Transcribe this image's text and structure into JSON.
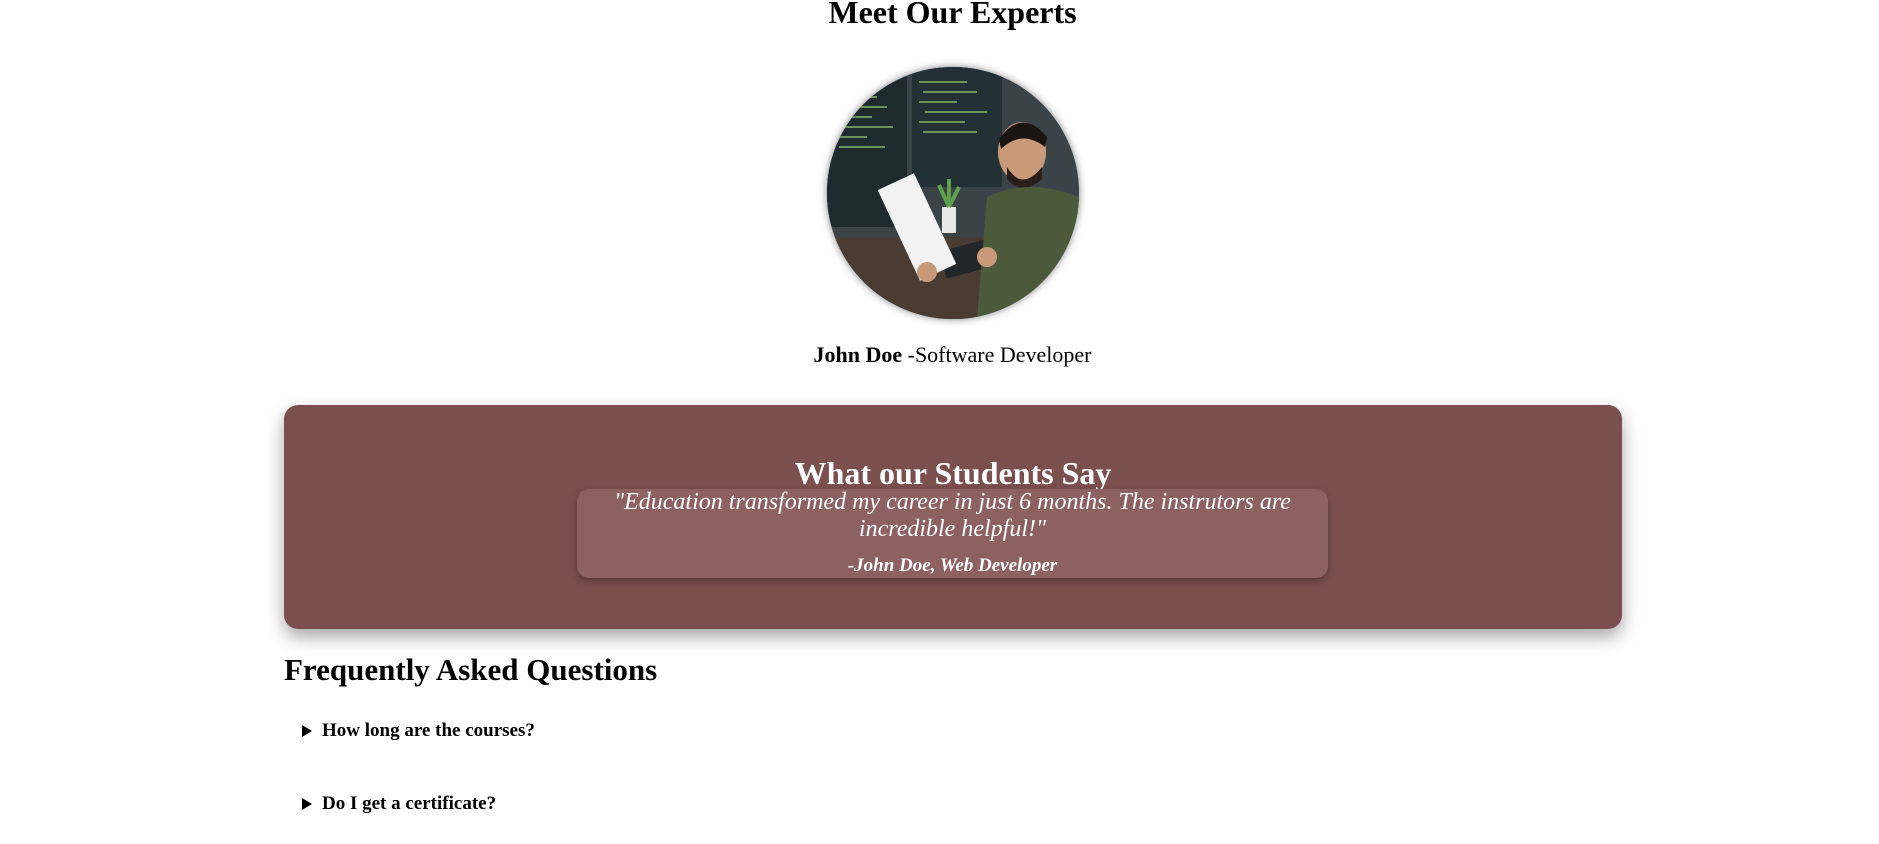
{
  "experts": {
    "title": "Meet Our Experts",
    "member": {
      "name": "John Doe",
      "role": "-Software Developer",
      "photo_icon": "developer-at-desk-photo"
    }
  },
  "testimonials": {
    "title": "What our Students Say",
    "quote": "\"Education transformed my career in just 6 months. The instrutors are incredible helpful!\"",
    "author": "-John Doe, Web Developer",
    "colors": {
      "panel": "#7c4f4f",
      "card": "#8d6161"
    }
  },
  "faq": {
    "title": "Frequently Asked Questions",
    "items": [
      {
        "question": "How long are the courses?"
      },
      {
        "question": "Do I get a certificate?"
      }
    ]
  }
}
